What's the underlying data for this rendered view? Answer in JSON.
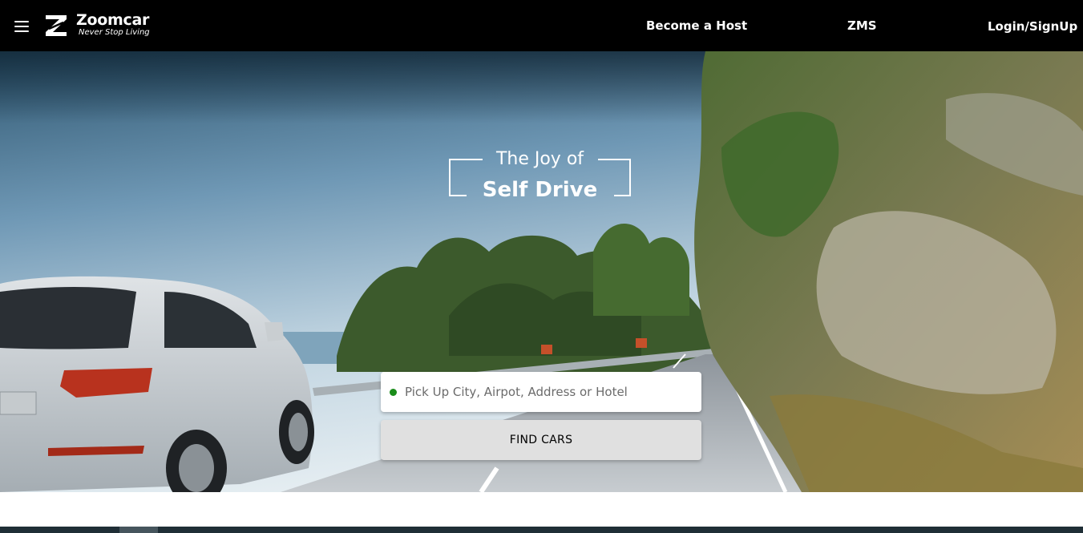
{
  "header": {
    "brand_name": "Zoomcar",
    "brand_tagline": "Never Stop Living",
    "menu_icon": "hamburger-menu-icon",
    "nav": {
      "become_host": "Become a Host",
      "zms": "ZMS",
      "login": "Login/SignUp"
    }
  },
  "hero": {
    "headline_line1": "The Joy of",
    "headline_line2": "Self Drive",
    "search": {
      "placeholder": "Pick Up City, Airpot, Address or Hotel",
      "value": "",
      "status_dot_color": "#1a8c1a"
    },
    "find_button": "FIND CARS"
  },
  "colors": {
    "header_bg": "#000000",
    "button_bg": "#e0e0e0",
    "accent_green": "#1a8c1a"
  }
}
